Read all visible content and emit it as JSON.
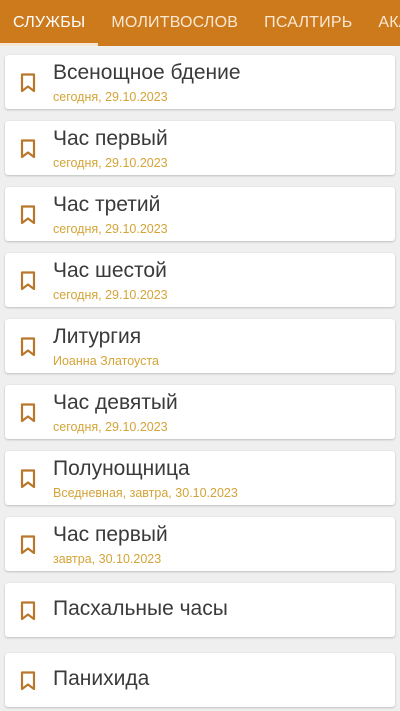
{
  "tabs": [
    {
      "label": "СЛУЖБЫ",
      "active": true
    },
    {
      "label": "МОЛИТВОСЛОВ",
      "active": false
    },
    {
      "label": "ПСАЛТИРЬ",
      "active": false
    },
    {
      "label": "АКА",
      "active": false
    }
  ],
  "services": [
    {
      "title": "Всенощное бдение",
      "subtitle": "сегодня, 29.10.2023",
      "icon": "bookmark-icon"
    },
    {
      "title": "Час первый",
      "subtitle": "сегодня, 29.10.2023",
      "icon": "bookmark-icon"
    },
    {
      "title": "Час третий",
      "subtitle": "сегодня, 29.10.2023",
      "icon": "bookmark-icon"
    },
    {
      "title": "Час шестой",
      "subtitle": "сегодня, 29.10.2023",
      "icon": "bookmark-icon"
    },
    {
      "title": "Литургия",
      "subtitle": "Иоанна Златоуста",
      "icon": "bookmark-icon"
    },
    {
      "title": "Час девятый",
      "subtitle": "сегодня, 29.10.2023",
      "icon": "bookmark-icon"
    },
    {
      "title": "Полунощница",
      "subtitle": "Вседневная, завтра, 30.10.2023",
      "icon": "bookmark-icon"
    },
    {
      "title": "Час первый",
      "subtitle": "завтра, 30.10.2023",
      "icon": "bookmark-icon"
    },
    {
      "title": "Пасхальные часы",
      "subtitle": "",
      "icon": "bookmark-icon"
    },
    {
      "title": "Панихида",
      "subtitle": "",
      "icon": "bookmark-icon"
    }
  ],
  "colors": {
    "accent": "#cd7a1d",
    "subtitle": "#d4a437",
    "icon": "#b8772a"
  }
}
